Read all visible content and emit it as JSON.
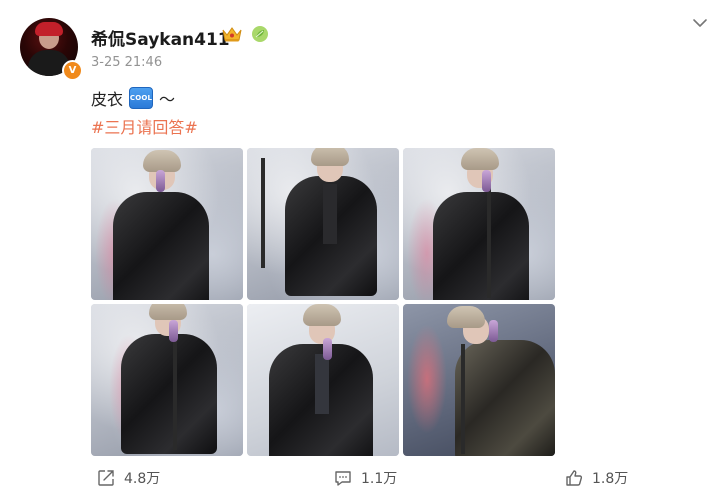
{
  "user": {
    "name": "希侃Saykan411",
    "verified_badge": "V"
  },
  "post": {
    "time": "3-25 21:46",
    "text": "皮衣",
    "emoji_label": "COOL",
    "text_suffix": "～",
    "hashtag": "#三月请回答#"
  },
  "actions": {
    "share_count": "4.8万",
    "comment_count": "1.1万",
    "like_count": "1.8万"
  },
  "icons": [
    "chevron-down-icon",
    "crown-icon",
    "leaf-icon",
    "share-icon",
    "comment-icon",
    "like-icon"
  ],
  "colors": {
    "hashtag": "#eb7350",
    "badge": "#f08a1c",
    "text": "#222222",
    "muted": "#939393"
  }
}
